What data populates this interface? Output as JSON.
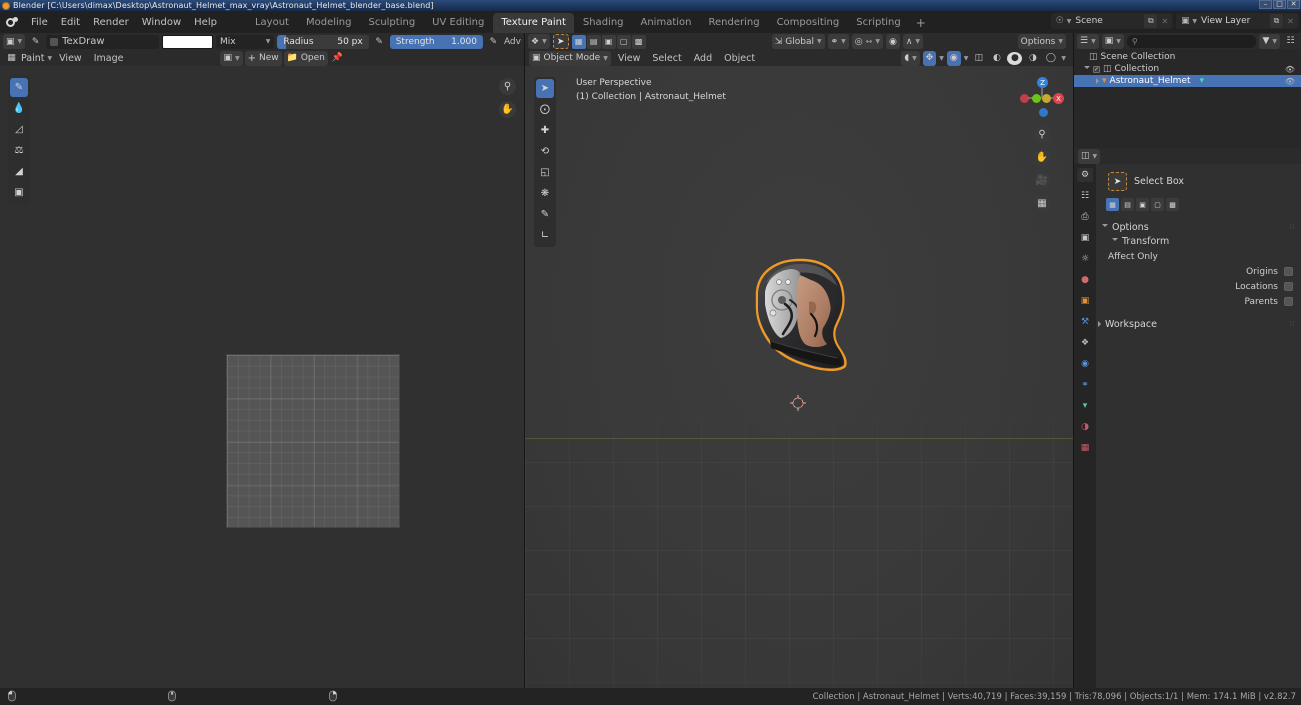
{
  "window": {
    "title": "Blender [C:\\Users\\dimax\\Desktop\\Astronaut_Helmet_max_vray\\Astronaut_Helmet_blender_base.blend]",
    "minimize": "–",
    "maximize": "□",
    "close": "✕"
  },
  "topbar": {
    "logo_icon": "blender-logo-icon",
    "menus": [
      "File",
      "Edit",
      "Render",
      "Window",
      "Help"
    ],
    "workspaces": [
      {
        "label": "Layout",
        "active": false
      },
      {
        "label": "Modeling",
        "active": false
      },
      {
        "label": "Sculpting",
        "active": false
      },
      {
        "label": "UV Editing",
        "active": false
      },
      {
        "label": "Texture Paint",
        "active": true
      },
      {
        "label": "Shading",
        "active": false
      },
      {
        "label": "Animation",
        "active": false
      },
      {
        "label": "Rendering",
        "active": false
      },
      {
        "label": "Compositing",
        "active": false
      },
      {
        "label": "Scripting",
        "active": false
      }
    ],
    "add_workspace": "+",
    "scene": {
      "icon": "scene-icon",
      "name": "Scene",
      "copy": "⧉",
      "remove": "✕"
    },
    "view_layer": {
      "icon": "view-layer-icon",
      "name": "View Layer",
      "copy": "⧉",
      "remove": "✕"
    }
  },
  "image_editor": {
    "brush_bar": {
      "brush_preset_icon": "brush-preset-icon",
      "brush_icon": "brush-icon",
      "brush_name": "TexDraw",
      "color_label": "",
      "blend_mode": "Mix",
      "radius_label": "Radius",
      "radius_value": "50 px",
      "radius_fraction": 0.1,
      "strength_label": "Strength",
      "strength_value": "1.000",
      "strength_fraction": 1.0,
      "advanced_label": "Adv",
      "pressure_icon": "pressure-icon"
    },
    "header": {
      "editor_icon": "image-editor-icon",
      "mode": "Paint",
      "menus": [
        "View",
        "Image"
      ],
      "datablock_icon": "image-datablock-icon",
      "new_label": "New",
      "open_label": "Open",
      "pin_icon": "pin-icon"
    },
    "tools": [
      {
        "name": "draw-tool",
        "icon": "✎",
        "active": true
      },
      {
        "name": "soften-tool",
        "icon": "●",
        "active": false
      },
      {
        "name": "smear-tool",
        "icon": "◔",
        "active": false
      },
      {
        "name": "clone-tool",
        "icon": "⚇",
        "active": false
      },
      {
        "name": "fill-tool",
        "icon": "◢",
        "active": false
      },
      {
        "name": "mask-tool",
        "icon": "❐",
        "active": false
      }
    ],
    "zoom_icon": "zoom-icon",
    "pan_icon": "hand-icon"
  },
  "viewport": {
    "header": {
      "editor_icon": "editor-type-icon",
      "select_tool_icon": "select-box-icon",
      "select_modes": [
        "new",
        "extend",
        "subtract",
        "invert",
        "intersect"
      ],
      "orientation_icon": "orientation-icon",
      "orientation": "Global",
      "snap_icon": "snap-magnet-icon",
      "pivot_icon": "pivot-icon",
      "proportional_icon": "proportional-edit-icon",
      "falloff_icon": "falloff-curve-icon",
      "options_label": "Options"
    },
    "header2": {
      "mode_icon": "object-mode-icon",
      "mode": "Object Mode",
      "menus": [
        "View",
        "Select",
        "Add",
        "Object"
      ],
      "visibility_icon": "visibility-icon",
      "gizmo_icon": "gizmo-icon",
      "overlays_icon": "overlays-icon",
      "xray_icon": "xray-icon",
      "shading_modes": [
        "wireframe",
        "solid",
        "material",
        "rendered"
      ],
      "active_shading": "solid"
    },
    "info_line1": "User Perspective",
    "info_line2": "(1) Collection | Astronaut_Helmet",
    "tools": [
      {
        "name": "select-box-tool",
        "icon": "➤",
        "active": true
      },
      {
        "name": "cursor-tool",
        "icon": "⊕",
        "active": false
      },
      {
        "name": "move-tool",
        "icon": "✛",
        "active": false
      },
      {
        "name": "rotate-tool",
        "icon": "↺",
        "active": false
      },
      {
        "name": "scale-tool",
        "icon": "◱",
        "active": false
      },
      {
        "name": "transform-tool",
        "icon": "✣",
        "active": false
      },
      {
        "name": "annotate-tool",
        "icon": "✎",
        "active": false
      },
      {
        "name": "measure-tool",
        "icon": "∠",
        "active": false
      }
    ],
    "gizmo": {
      "z_label": "Z",
      "x_label": "X",
      "z_color": "#2f83e3",
      "y_color": "#6cc417",
      "x_color": "#e0424a"
    },
    "nav_buttons": [
      {
        "name": "zoom-button",
        "icon": "⌕"
      },
      {
        "name": "pan-button",
        "icon": "✋"
      },
      {
        "name": "camera-view-button",
        "icon": "▣"
      },
      {
        "name": "toggle-perspective-button",
        "icon": "▦"
      }
    ],
    "object_name": "Astronaut_Helmet"
  },
  "outliner": {
    "display_mode_icon": "outliner-display-mode-icon",
    "filter_id_icon": "filter-id-icon",
    "search_icon": "search-icon",
    "search_placeholder": "",
    "filter_icon": "filter-funnel-icon",
    "new_collection_icon": "new-collection-icon",
    "rows": [
      {
        "label": "Scene Collection",
        "indent": 0,
        "icon": "collection-icon",
        "selected": false,
        "has_eye": false,
        "expander": "none",
        "checkbox": false
      },
      {
        "label": "Collection",
        "indent": 1,
        "icon": "collection-icon",
        "selected": false,
        "has_eye": true,
        "expander": "down",
        "checkbox": true
      },
      {
        "label": "Astronaut_Helmet",
        "indent": 2,
        "icon": "mesh-object-icon",
        "selected": true,
        "has_eye": true,
        "expander": "right",
        "checkbox": false,
        "data_icon": "mesh-data-icon"
      }
    ]
  },
  "properties": {
    "header_icon": "properties-editor-icon",
    "tabs": [
      {
        "name": "tool-tab",
        "icon": "⚙",
        "active": true,
        "color": "#c9c9c9"
      },
      {
        "name": "render-tab",
        "icon": "☗",
        "active": false,
        "color": "#c9c9c9"
      },
      {
        "name": "output-tab",
        "icon": "⎙",
        "active": false,
        "color": "#bdbdbd"
      },
      {
        "name": "view-layer-tab",
        "icon": "◫",
        "active": false,
        "color": "#bdbdbd"
      },
      {
        "name": "scene-tab",
        "icon": "◳",
        "active": false,
        "color": "#bdbdbd"
      },
      {
        "name": "world-tab",
        "icon": "●",
        "active": false,
        "color": "#d16a6a"
      },
      {
        "name": "object-tab",
        "icon": "▣",
        "active": false,
        "color": "#e0913a"
      },
      {
        "name": "modifier-tab",
        "icon": "🔧",
        "active": false,
        "color": "#5b8ed6"
      },
      {
        "name": "particles-tab",
        "icon": "⁂",
        "active": false,
        "color": "#b9b9b9"
      },
      {
        "name": "physics-tab",
        "icon": "◌",
        "active": false,
        "color": "#5b8ed6"
      },
      {
        "name": "constraints-tab",
        "icon": "⛓",
        "active": false,
        "color": "#5b8ed6"
      },
      {
        "name": "data-tab",
        "icon": "▽",
        "active": false,
        "color": "#5bc8a0"
      },
      {
        "name": "material-tab",
        "icon": "◕",
        "active": false,
        "color": "#d1566b"
      },
      {
        "name": "texture-tab",
        "icon": "▦",
        "active": false,
        "color": "#d1566b"
      }
    ],
    "active_tool": {
      "label": "Select Box",
      "icon": "select-box-icon"
    },
    "select_modes": [
      {
        "name": "set-mode",
        "active": true
      },
      {
        "name": "extend-mode",
        "active": false
      },
      {
        "name": "subtract-mode",
        "active": false
      },
      {
        "name": "invert-mode",
        "active": false
      },
      {
        "name": "intersect-mode",
        "active": false
      }
    ],
    "options_panel": {
      "title": "Options",
      "transform_title": "Transform",
      "affect_only_label": "Affect Only",
      "fields": [
        {
          "label": "Origins",
          "checked": false
        },
        {
          "label": "Locations",
          "checked": false
        },
        {
          "label": "Parents",
          "checked": false
        }
      ]
    },
    "workspace_panel": {
      "title": "Workspace"
    }
  },
  "statusbar": {
    "mouse_hints": [
      "mouse-left-icon",
      "mouse-middle-icon",
      "mouse-right-icon"
    ],
    "info": "Collection | Astronaut_Helmet | Verts:40,719 | Faces:39,159 | Tris:78,096 | Objects:1/1 | Mem: 174.1 MiB | v2.82.7"
  }
}
